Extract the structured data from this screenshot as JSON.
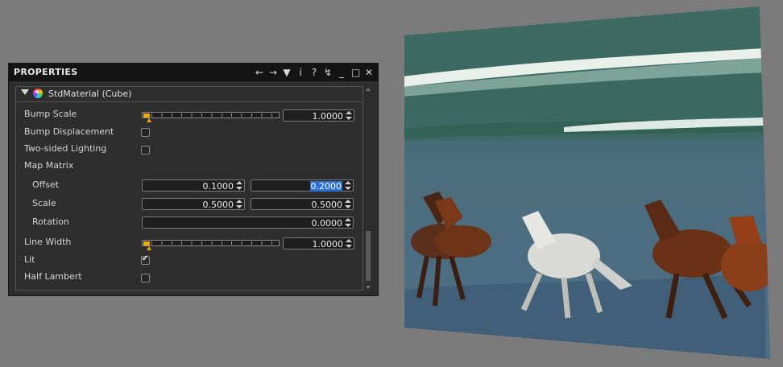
{
  "panel": {
    "title": "PROPERTIES",
    "toolbar_icons": [
      "arrow-left-icon",
      "arrow-right-icon",
      "dropdown-icon",
      "info-icon",
      "help-icon",
      "pin-icon",
      "minimize-icon",
      "maximize-icon",
      "close-icon"
    ],
    "section_title": "StdMaterial (Cube)",
    "rows": {
      "bump_scale": {
        "label": "Bump Scale",
        "value": "1.0000",
        "slider_fraction": 0.04
      },
      "bump_displacement": {
        "label": "Bump Displacement",
        "checked": false
      },
      "two_sided": {
        "label": "Two-sided Lighting",
        "checked": false
      },
      "map_matrix": {
        "label": "Map Matrix"
      },
      "offset": {
        "label": "Offset",
        "x": "0.1000",
        "y": "0.2000"
      },
      "scale": {
        "label": "Scale",
        "x": "0.5000",
        "y": "0.5000"
      },
      "rotation": {
        "label": "Rotation",
        "value": "0.0000"
      },
      "line_width": {
        "label": "Line Width",
        "value": "1.0000",
        "slider_fraction": 0.04
      },
      "lit": {
        "label": "Lit",
        "checked": true
      },
      "half_lambert": {
        "label": "Half Lambert",
        "checked": false
      }
    }
  },
  "colors": {
    "background": "#7b7b7b",
    "panel_bg": "#2e2e2e",
    "titlebar": "#141414",
    "slider_accent": "#f2a900",
    "selection": "#2a6ed6"
  }
}
